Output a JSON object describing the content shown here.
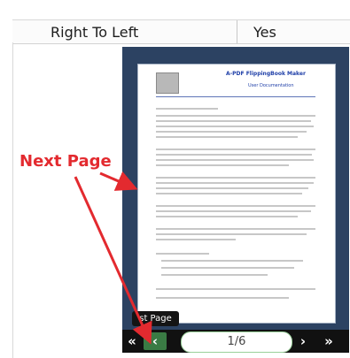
{
  "property_row": {
    "name": "Right To Left",
    "value": "Yes"
  },
  "annotation": {
    "label": "Next Page",
    "color": "#e32a2f"
  },
  "page_preview": {
    "title": "A-PDF FlippingBook Maker",
    "subtitle": "User Documentation"
  },
  "toolbar": {
    "first_label": "«",
    "prev_label": "‹",
    "page_counter": "1/6",
    "next_label": "›",
    "last_label": "»",
    "tooltip": "st Page"
  }
}
